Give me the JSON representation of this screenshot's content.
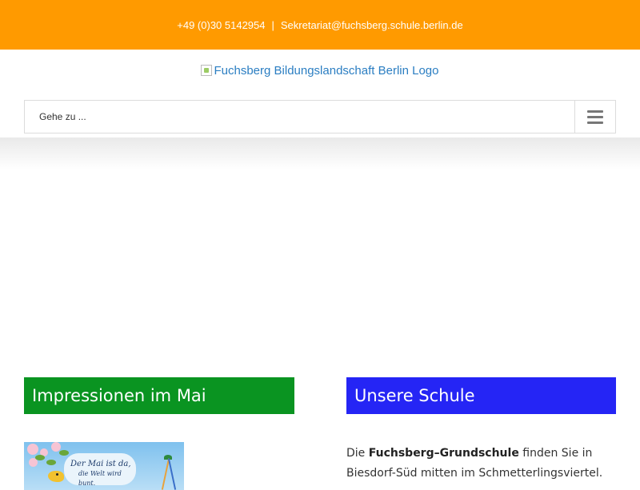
{
  "topbar": {
    "phone": "+49 (0)30 5142954",
    "separator": "|",
    "email": "Sekretariat@fuchsberg.schule.berlin.de",
    "background": "#ff9a00"
  },
  "logo": {
    "alt": "Fuchsberg Bildungslandschaft Berlin Logo"
  },
  "nav": {
    "select_label": "Gehe zu ...",
    "menu_icon": "hamburger-icon"
  },
  "sections": {
    "left": {
      "title": "Impressionen im Mai",
      "color": "#0a9421",
      "thumbnail": {
        "line1": "Der Mai ist da,",
        "line2": "die Welt wird bunt."
      }
    },
    "right": {
      "title": "Unsere Schule",
      "color": "#2525f5",
      "intro_prefix": "Die ",
      "intro_bold": "Fuchsberg–Grundschule",
      "intro_suffix": " finden Sie in Biesdorf-Süd mitten im Schmetterlingsviertel."
    }
  }
}
